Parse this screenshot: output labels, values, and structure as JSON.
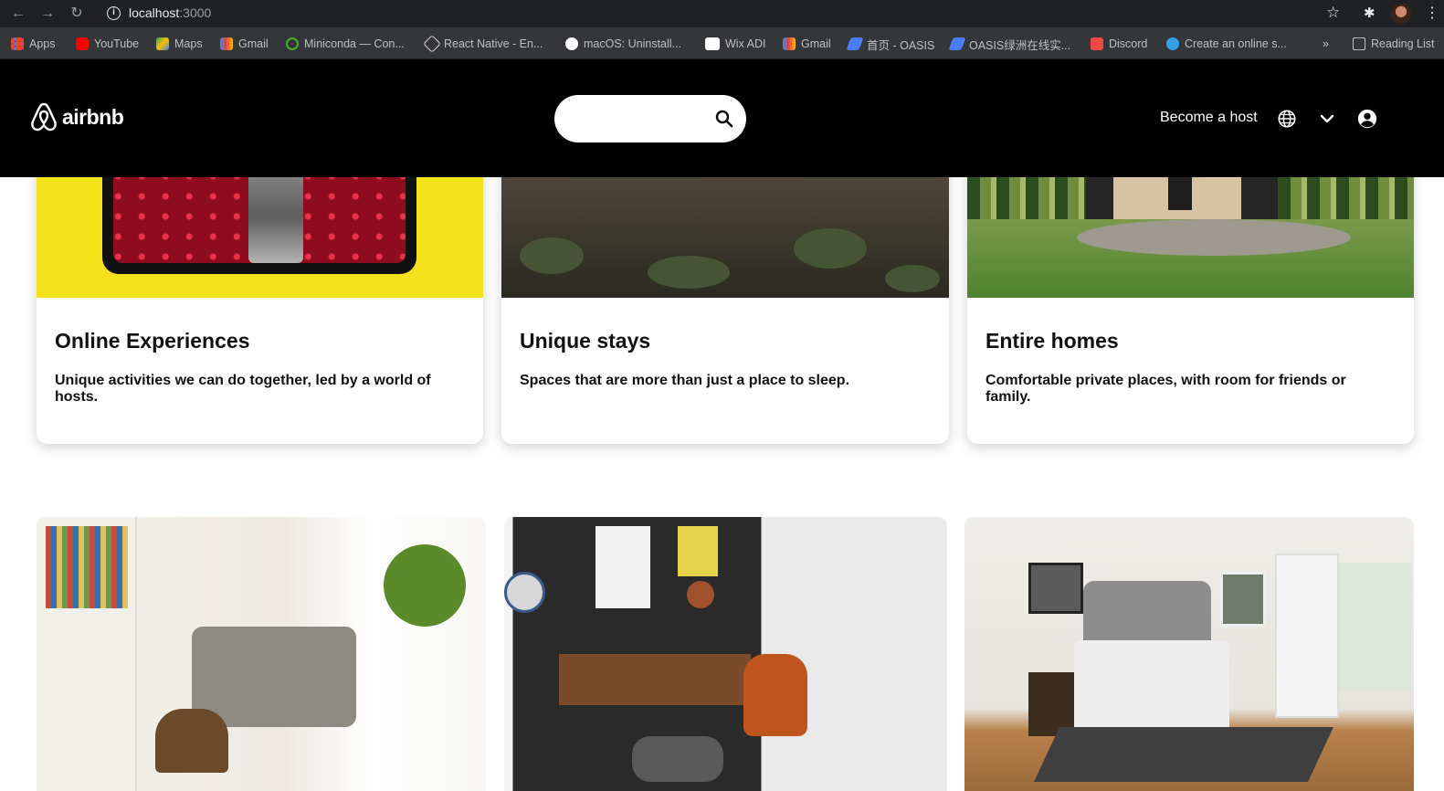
{
  "browser": {
    "url_host": "localhost",
    "url_port": ":3000",
    "bookmarks": [
      {
        "label": "Apps",
        "icon": "apps-grid-icon",
        "color": "#e94235"
      },
      {
        "label": "YouTube",
        "icon": "youtube-icon",
        "color": "#ff0000"
      },
      {
        "label": "Maps",
        "icon": "maps-icon",
        "color": "#34a853"
      },
      {
        "label": "Gmail",
        "icon": "gmail-icon",
        "color": "#ea4335"
      },
      {
        "label": "Miniconda — Con...",
        "icon": "miniconda-icon",
        "color": "#43b02a"
      },
      {
        "label": "React Native - En...",
        "icon": "react-native-icon",
        "color": "#dddddd"
      },
      {
        "label": "macOS: Uninstall...",
        "icon": "github-icon",
        "color": "#ffffff"
      },
      {
        "label": "Wix ADI",
        "icon": "wix-icon",
        "color": "#ffffff"
      },
      {
        "label": "Gmail",
        "icon": "gmail-icon",
        "color": "#ea4335"
      },
      {
        "label": "首页 - OASIS",
        "icon": "oasis-icon",
        "color": "#4a7dff"
      },
      {
        "label": "OASIS绿洲在线实...",
        "icon": "oasis-icon",
        "color": "#4a7dff"
      },
      {
        "label": "Discord",
        "icon": "discord-icon",
        "color": "#f04747"
      },
      {
        "label": "Create an online s...",
        "icon": "gear-icon",
        "color": "#30a2e5"
      }
    ],
    "overflow": "»",
    "reading_list": "Reading List"
  },
  "header": {
    "logo_text": "airbnb",
    "search_placeholder": "",
    "become_host": "Become a host"
  },
  "cards": [
    {
      "title": "Online Experiences",
      "description": "Unique activities we can do together, led by a world of hosts."
    },
    {
      "title": "Unique stays",
      "description": "Spaces that are more than just a place to sleep."
    },
    {
      "title": "Entire homes",
      "description": "Comfortable private places, with room for friends or family."
    }
  ],
  "colors": {
    "header_bg": "#000000",
    "chrome_bg": "#202124",
    "bookmarks_bg": "#35363a"
  }
}
